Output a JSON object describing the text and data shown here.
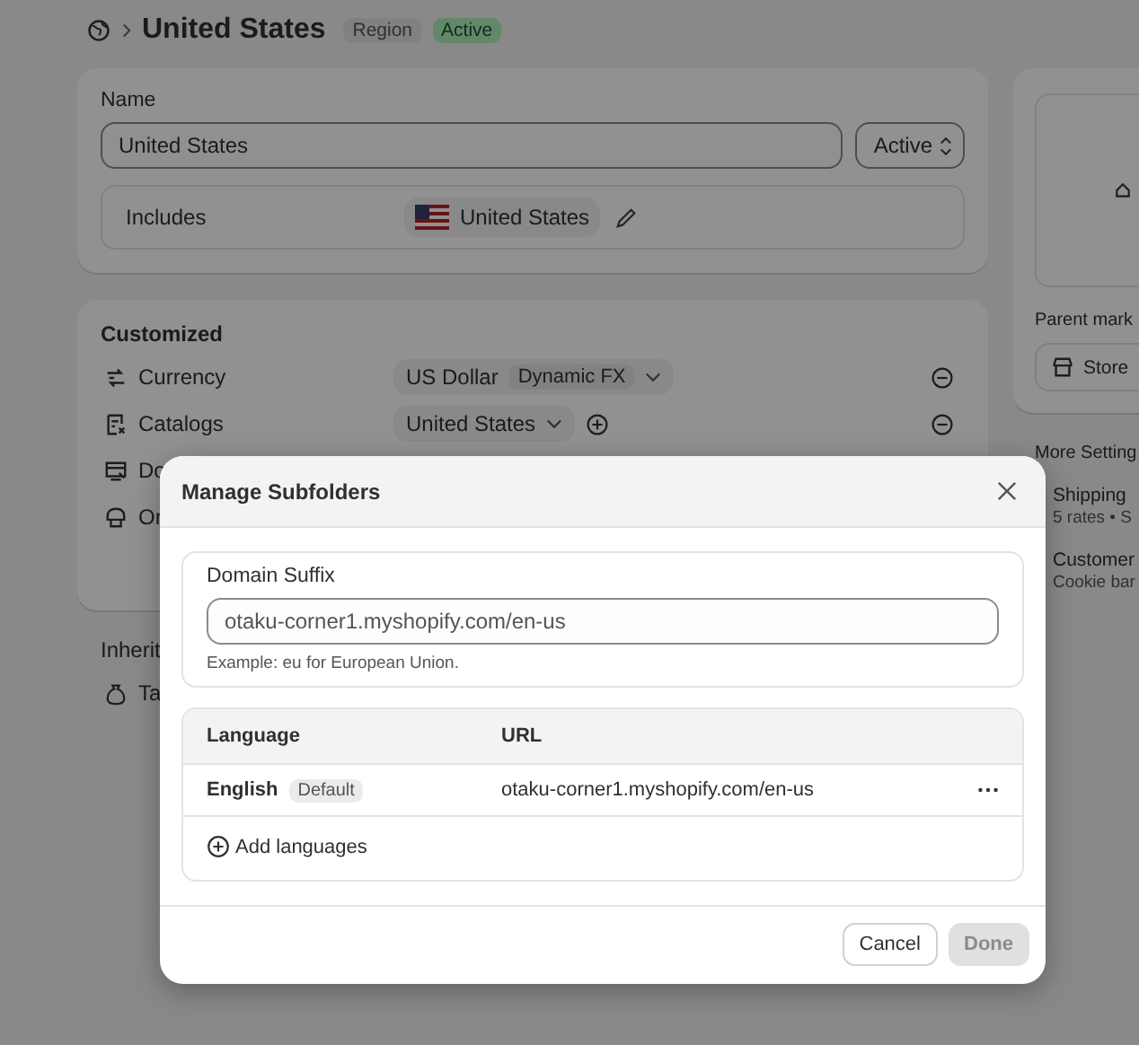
{
  "breadcrumb": {
    "title": "United States",
    "badges": [
      {
        "label": "Region",
        "kind": "neutral"
      },
      {
        "label": "Active",
        "kind": "success"
      }
    ]
  },
  "name_card": {
    "label": "Name",
    "value": "United States",
    "status": "Active",
    "includes_label": "Includes",
    "includes_value": "United States"
  },
  "customized": {
    "title": "Customized",
    "rows": [
      {
        "kind": "currency",
        "label": "Currency",
        "value": "US Dollar",
        "tag": "Dynamic FX"
      },
      {
        "kind": "catalogs",
        "label": "Catalogs",
        "value": "United States"
      },
      {
        "kind": "domains",
        "label": "Do"
      },
      {
        "kind": "online",
        "label": "Or"
      }
    ]
  },
  "inherited": {
    "title": "Inherit",
    "rows": [
      {
        "kind": "taxes",
        "label": "Ta"
      }
    ]
  },
  "sidebar": {
    "parent_label": "Parent mark",
    "store_button": "Store",
    "more_title": "More Setting",
    "items": [
      {
        "title": "Shipping",
        "subtitle": "5 rates • S"
      },
      {
        "title": "Customer",
        "subtitle": "Cookie bar"
      }
    ]
  },
  "modal": {
    "title": "Manage Subfolders",
    "domain_label": "Domain Suffix",
    "domain_value": "otaku-corner1.myshopify.com/en-us",
    "domain_help": "Example: eu for European Union.",
    "columns": [
      "Language",
      "URL"
    ],
    "rows": [
      {
        "language": "English",
        "badge": "Default",
        "url": "otaku-corner1.myshopify.com/en-us"
      }
    ],
    "add_button": "Add languages",
    "cancel_button": "Cancel",
    "done_button": {
      "label": "Done",
      "disabled": true
    }
  }
}
